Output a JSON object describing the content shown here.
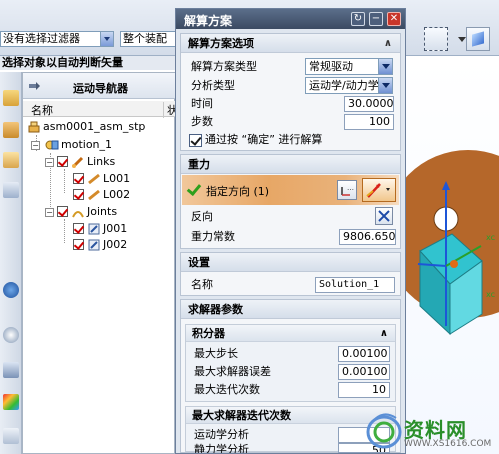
{
  "toolbar": {
    "filter_select": "没有选择过滤器",
    "assembly_select": "整个装配"
  },
  "hint_bar": "选择对象以自动判断矢量",
  "navigator": {
    "title": "运动导航器",
    "columns": [
      "名称",
      "状"
    ],
    "tree": [
      {
        "label": "asm0001_asm_stp"
      },
      {
        "label": "motion_1"
      },
      {
        "label": "Links"
      },
      {
        "label": "L001"
      },
      {
        "label": "L002"
      },
      {
        "label": "Joints"
      },
      {
        "label": "J001"
      },
      {
        "label": "J002"
      }
    ]
  },
  "dialog": {
    "title": "解算方案",
    "options": {
      "header": "解算方案选项",
      "type_label": "解算方案类型",
      "type_value": "常规驱动",
      "analysis_label": "分析类型",
      "analysis_value": "运动学/动力学",
      "time_label": "时间",
      "time_value": "30.00000",
      "steps_label": "步数",
      "steps_value": "100",
      "solve_on_ok_label": "通过按 “确定” 进行解算"
    },
    "gravity": {
      "header": "重力",
      "specify_direction": "指定方向 (1)",
      "reverse_label": "反向",
      "constant_label": "重力常数",
      "constant_value": "9806.6500"
    },
    "settings": {
      "header": "设置",
      "name_label": "名称",
      "name_value": "Solution_1"
    },
    "solver": {
      "header": "求解器参数",
      "integrator_header": "积分器",
      "max_step_label": "最大步长",
      "max_step_value": "0.00100",
      "max_error_label": "最大求解器误差",
      "max_error_value": "0.00100",
      "max_iter_label": "最大迭代次数",
      "max_iter_value": "10",
      "iter_header": "最大求解器迭代次数",
      "kinematic_label": "运动学分析",
      "kinematic_value": "",
      "static_label": "静力学分析",
      "static_value": "50"
    }
  },
  "view": {
    "axis_label_x": "xc",
    "axis_label_y": "xc"
  },
  "watermark": {
    "main": "资料网",
    "url": "WWW.XS1616.COM"
  },
  "colors": {
    "title_bar": "#3b4a62",
    "disk": "#b5672a",
    "accent_orange": "#e7a766"
  }
}
